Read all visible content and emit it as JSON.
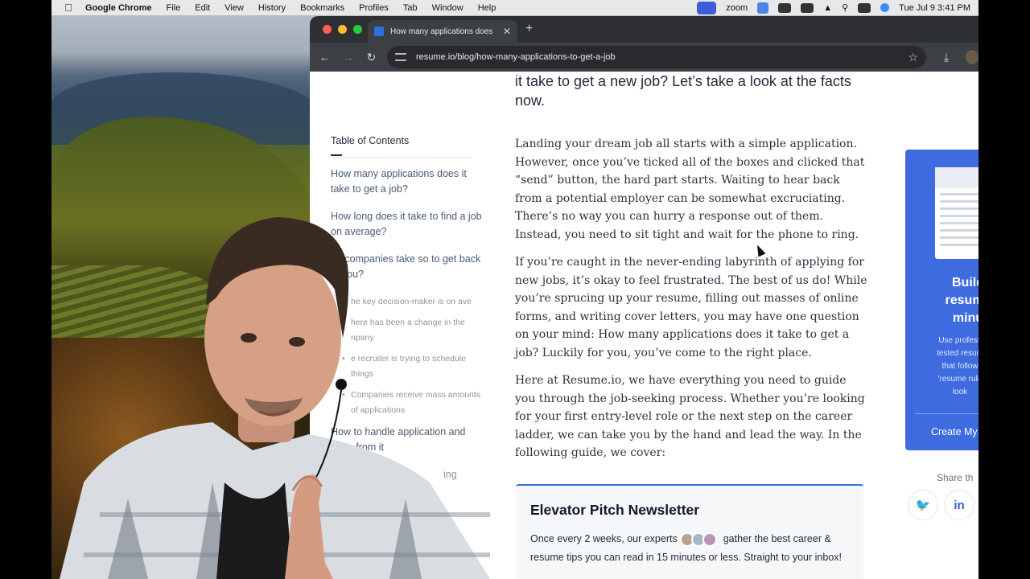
{
  "menubar": {
    "app_name": "Google Chrome",
    "items": [
      "File",
      "Edit",
      "View",
      "History",
      "Bookmarks",
      "Profiles",
      "Tab",
      "Window",
      "Help"
    ],
    "zoom_label": "zoom",
    "clock": "Tue Jul 9  3:41 PM"
  },
  "browser": {
    "tab_title": "How many applications does",
    "url": "resume.io/blog/how-many-applications-to-get-a-job"
  },
  "article": {
    "lead_text": "it take to get a new job? Let’s take a look at the facts now.",
    "paragraphs": [
      "Landing your dream job all starts with a simple application. However, once you’ve ticked all of the boxes and clicked that “send” button, the hard part starts. Waiting to hear back from a potential employer can be somewhat excruciating. There’s no way you can hurry a response out of them. Instead, you need to sit tight and wait for the phone to ring.",
      "If you’re caught in the never-ending labyrinth of applying for new jobs, it’s okay to feel frustrated. The best of us do! While you’re sprucing up your resume, filling out masses of online forms, and writing cover letters, you may have one question on your mind: How many applications does it take to get a job? Luckily for you, you’ve come to the right place.",
      "Here at Resume.io, we have everything you need to guide you through the job-seeking process. Whether you’re looking for your first entry-level role or the next step on the career ladder, we can take you by the hand and lead the way. In the following guide, we cover:"
    ]
  },
  "toc": {
    "title": "Table of Contents",
    "items": [
      "How many applications does it take to get a job?",
      "How long does it take to find a job on average?",
      "do companies take so to get back to you?"
    ],
    "subitems": [
      "he key decision-maker is on ave",
      "here has been a change in the npany",
      "e recruiter is trying to schedule things",
      "Companies receive mass amounts of applications"
    ],
    "item_after": "How to handle application and learn from it",
    "item_last": "ing"
  },
  "newsletter": {
    "title": "Elevator Pitch Newsletter",
    "text_before": "Once every 2 weeks, our experts",
    "text_after": "gather the best career & resume tips you can read in 15 minutes or less. Straight to your inbox!"
  },
  "promo": {
    "heading_lines": [
      "Build",
      "resume",
      "minu"
    ],
    "blurb_lines": [
      "Use profess",
      "tested resum",
      "that follow",
      "'resume rule",
      "look"
    ],
    "cta": "Create My"
  },
  "share": {
    "label": "Share th",
    "twitter_glyph": "🐦",
    "linkedin_glyph": "in"
  },
  "colors": {
    "accent": "#3e6be0",
    "chrome_dark": "#3c3f43"
  }
}
